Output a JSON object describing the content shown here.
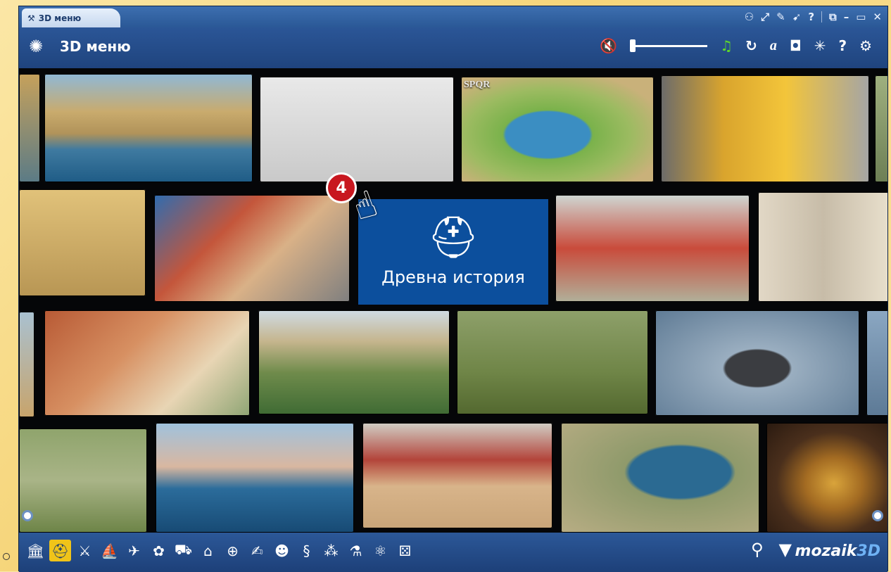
{
  "window": {
    "tab_label": "3D меню",
    "title": "3D меню"
  },
  "toolbar": {
    "volume_icon": "mute-speaker-icon",
    "volume_level": 0.0,
    "music_icon": "music-note-icon",
    "refresh_icon": "refresh-icon",
    "font_icon": "font-style-icon",
    "camera_icon": "camera-icon",
    "effects_icon": "sparkle-icon",
    "help_icon": "help-icon",
    "settings_icon": "gear-icon"
  },
  "gallery": {
    "center_label": "Древна история",
    "badge_number": "4",
    "map_caption": "SPQR"
  },
  "categories": [
    {
      "name": "column",
      "active": false
    },
    {
      "name": "spartan-helmet",
      "active": true
    },
    {
      "name": "armor",
      "active": false
    },
    {
      "name": "ship",
      "active": false
    },
    {
      "name": "airplane",
      "active": false
    },
    {
      "name": "plants",
      "active": false
    },
    {
      "name": "car",
      "active": false
    },
    {
      "name": "factory",
      "active": false
    },
    {
      "name": "globe",
      "active": false
    },
    {
      "name": "art",
      "active": false
    },
    {
      "name": "anatomy",
      "active": false
    },
    {
      "name": "dna",
      "active": false
    },
    {
      "name": "molecule",
      "active": false
    },
    {
      "name": "chemistry",
      "active": false
    },
    {
      "name": "atom",
      "active": false
    },
    {
      "name": "dice",
      "active": false
    }
  ],
  "brand": {
    "text": "mozaik",
    "suffix": "3D"
  },
  "colors": {
    "accent": "#f0c419",
    "window_blue": "#1f3f74",
    "center_tile": "#0c4f9d",
    "badge_red": "#c8171f"
  }
}
